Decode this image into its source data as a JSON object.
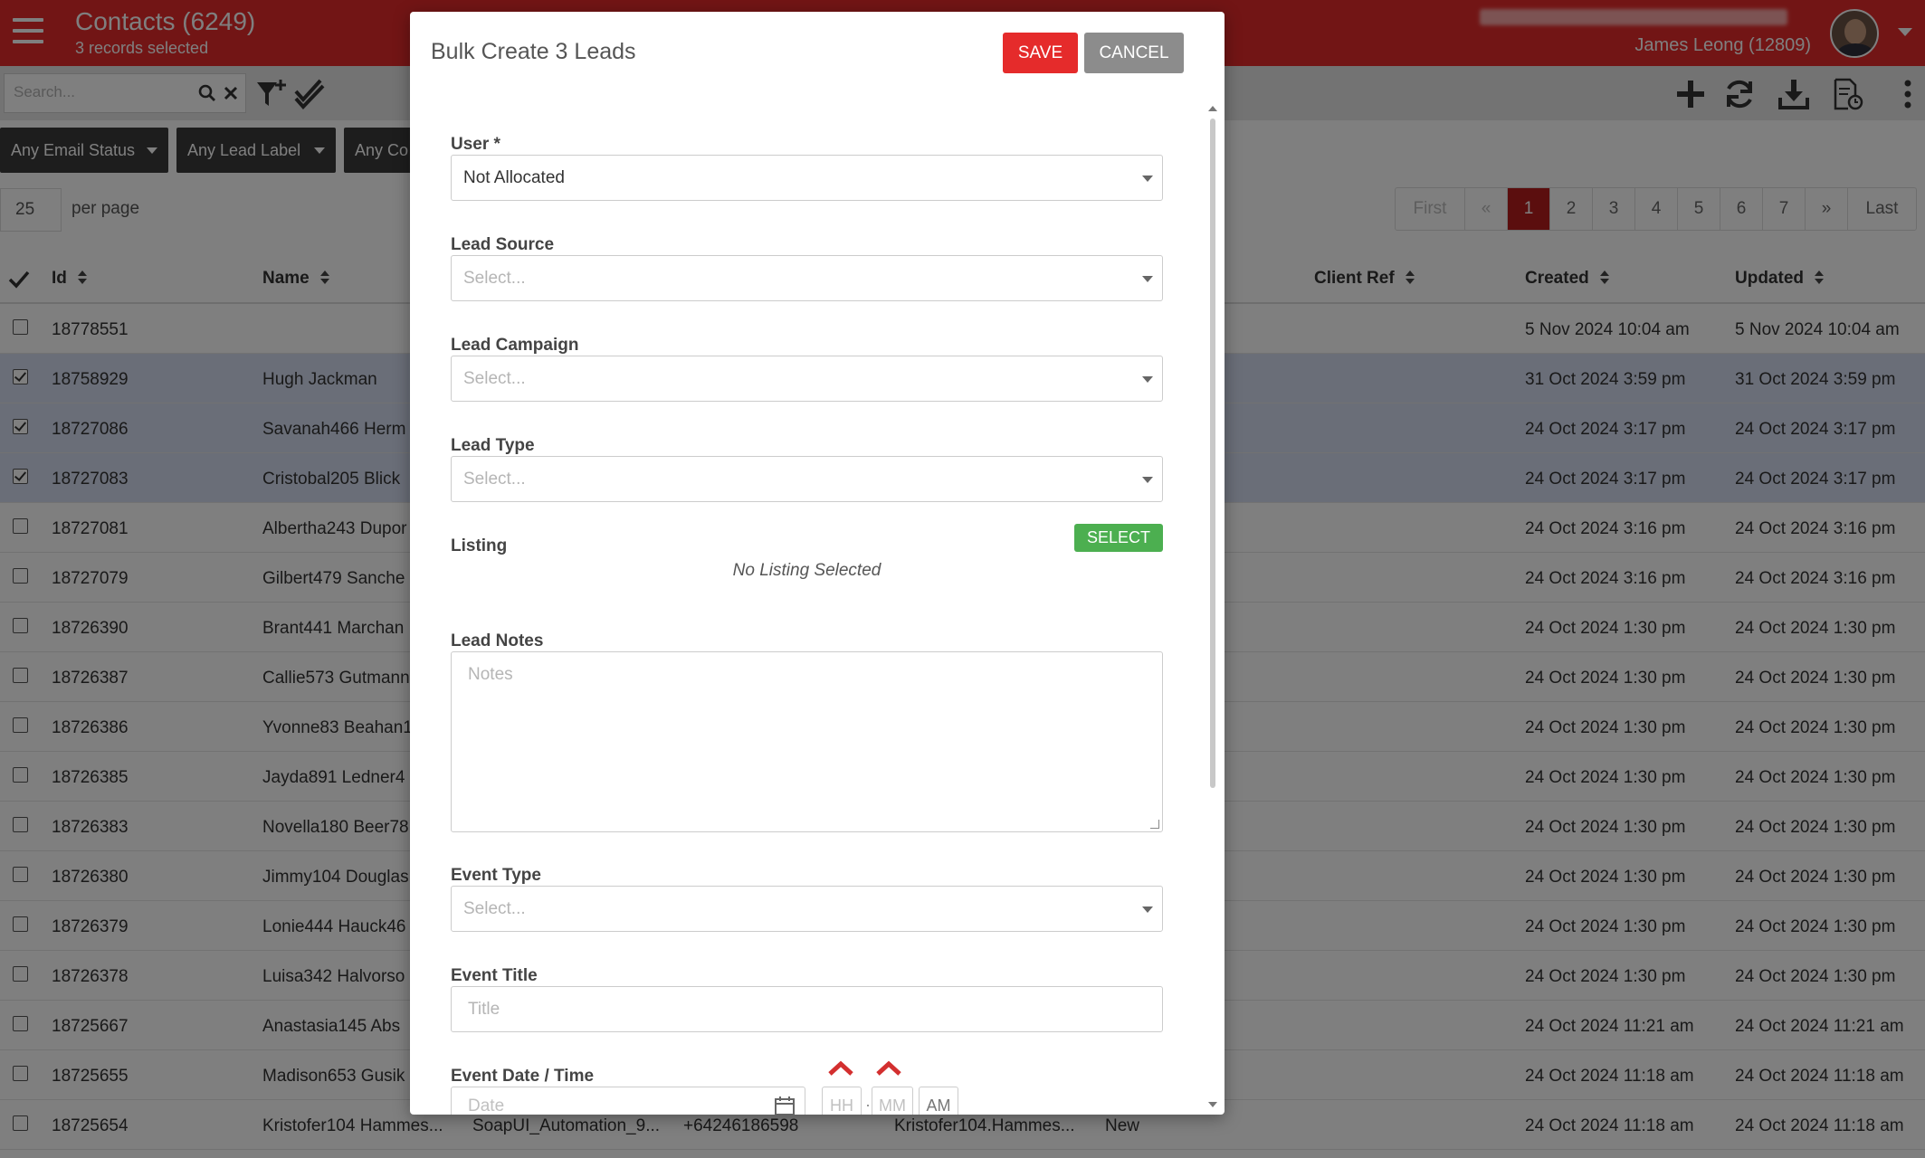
{
  "header": {
    "title": "Contacts (6249)",
    "subtitle": "3 records selected",
    "user_name": "James Leong (12809)"
  },
  "toolbar": {
    "search_placeholder": "Search..."
  },
  "filters": [
    "Any Email Status",
    "Any Lead Label",
    "Any Co"
  ],
  "paging": {
    "per_page": "25",
    "per_page_label": "per page",
    "pages": [
      "First",
      "«",
      "1",
      "2",
      "3",
      "4",
      "5",
      "6",
      "7",
      "»",
      "Last"
    ],
    "active_page": "1"
  },
  "table": {
    "columns": [
      "Id",
      "Name",
      "Client Ref",
      "Created",
      "Updated"
    ],
    "rows": [
      {
        "id": "18778551",
        "name": "",
        "created": "5 Nov 2024 10:04 am",
        "updated": "5 Nov 2024 10:04 am",
        "selected": false
      },
      {
        "id": "18758929",
        "name": "Hugh Jackman",
        "created": "31 Oct 2024 3:59 pm",
        "updated": "31 Oct 2024 3:59 pm",
        "selected": true
      },
      {
        "id": "18727086",
        "name": "Savanah466 Herm",
        "created": "24 Oct 2024 3:17 pm",
        "updated": "24 Oct 2024 3:17 pm",
        "selected": true
      },
      {
        "id": "18727083",
        "name": "Cristobal205 Blick",
        "created": "24 Oct 2024 3:17 pm",
        "updated": "24 Oct 2024 3:17 pm",
        "selected": true
      },
      {
        "id": "18727081",
        "name": "Albertha243 Dupor",
        "created": "24 Oct 2024 3:16 pm",
        "updated": "24 Oct 2024 3:16 pm",
        "selected": false
      },
      {
        "id": "18727079",
        "name": "Gilbert479 Sanche",
        "created": "24 Oct 2024 3:16 pm",
        "updated": "24 Oct 2024 3:16 pm",
        "selected": false
      },
      {
        "id": "18726390",
        "name": "Brant441 Marchan",
        "created": "24 Oct 2024 1:30 pm",
        "updated": "24 Oct 2024 1:30 pm",
        "selected": false
      },
      {
        "id": "18726387",
        "name": "Callie573 Gutmann",
        "created": "24 Oct 2024 1:30 pm",
        "updated": "24 Oct 2024 1:30 pm",
        "selected": false
      },
      {
        "id": "18726386",
        "name": "Yvonne83 Beahan1",
        "created": "24 Oct 2024 1:30 pm",
        "updated": "24 Oct 2024 1:30 pm",
        "selected": false
      },
      {
        "id": "18726385",
        "name": "Jayda891 Ledner4",
        "created": "24 Oct 2024 1:30 pm",
        "updated": "24 Oct 2024 1:30 pm",
        "selected": false
      },
      {
        "id": "18726383",
        "name": "Novella180 Beer78",
        "created": "24 Oct 2024 1:30 pm",
        "updated": "24 Oct 2024 1:30 pm",
        "selected": false
      },
      {
        "id": "18726380",
        "name": "Jimmy104 Douglas",
        "created": "24 Oct 2024 1:30 pm",
        "updated": "24 Oct 2024 1:30 pm",
        "selected": false
      },
      {
        "id": "18726379",
        "name": "Lonie444 Hauck46",
        "created": "24 Oct 2024 1:30 pm",
        "updated": "24 Oct 2024 1:30 pm",
        "selected": false
      },
      {
        "id": "18726378",
        "name": "Luisa342 Halvorso",
        "created": "24 Oct 2024 1:30 pm",
        "updated": "24 Oct 2024 1:30 pm",
        "selected": false
      },
      {
        "id": "18725667",
        "name": "Anastasia145 Abs",
        "created": "24 Oct 2024 11:21 am",
        "updated": "24 Oct 2024 11:21 am",
        "selected": false
      },
      {
        "id": "18725655",
        "name": "Madison653 Gusik",
        "created": "24 Oct 2024 11:18 am",
        "updated": "24 Oct 2024 11:18 am",
        "selected": false
      },
      {
        "id": "18725654",
        "name": "Kristofer104 Hammes...",
        "extra1": "SoapUI_Automation_9...",
        "extra2": "+64246186598",
        "extra3": "Kristofer104.Hammes...",
        "extra4": "New",
        "created": "24 Oct 2024 11:18 am",
        "updated": "24 Oct 2024 11:18 am",
        "selected": false
      }
    ]
  },
  "modal": {
    "title": "Bulk Create 3 Leads",
    "save_label": "SAVE",
    "cancel_label": "CANCEL",
    "user_label": "User *",
    "user_value": "Not Allocated",
    "lead_source_label": "Lead Source",
    "lead_campaign_label": "Lead Campaign",
    "lead_type_label": "Lead Type",
    "select_placeholder": "Select...",
    "listing_label": "Listing",
    "listing_select_label": "SELECT",
    "listing_empty": "No Listing Selected",
    "lead_notes_label": "Lead Notes",
    "notes_placeholder": "Notes",
    "event_type_label": "Event Type",
    "event_title_label": "Event Title",
    "title_placeholder": "Title",
    "event_datetime_label": "Event Date / Time",
    "date_placeholder": "Date",
    "hh_placeholder": "HH",
    "mm_placeholder": "MM",
    "ampm": "AM"
  },
  "colors": {
    "brand_red": "#e52b2b",
    "active_page": "#b71c1c",
    "select_green": "#4caf50",
    "selected_row": "#d4dcf0"
  }
}
